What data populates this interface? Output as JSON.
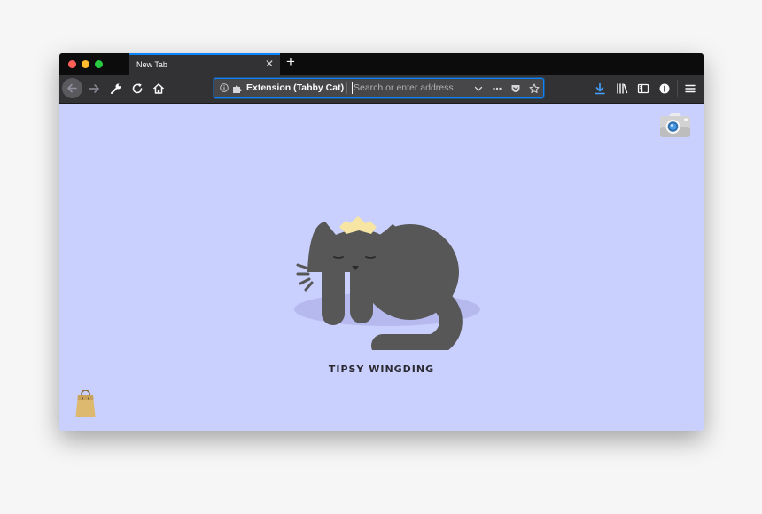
{
  "tab": {
    "title": "New Tab"
  },
  "urlbar": {
    "extension_label": "Extension (Tabby Cat)",
    "placeholder": "Search or enter address"
  },
  "cat": {
    "name": "TIPSY WINGDING"
  },
  "colors": {
    "content_bg": "#cad0fd",
    "cat_fur": "#575757",
    "crown": "#f7e5a3",
    "accent": "#0a84ff",
    "download_icon": "#45a1ff"
  },
  "icons": {
    "toolbar": [
      "back-icon",
      "forward-icon",
      "customize-wrench-icon",
      "reload-icon",
      "home-icon"
    ],
    "urlbar": [
      "info-icon",
      "extension-puzzle-icon",
      "dropdown-chevron-icon",
      "page-actions-icon",
      "pocket-icon",
      "bookmark-star-icon"
    ],
    "right": [
      "downloads-icon",
      "library-icon",
      "sidebar-icon",
      "account-icon",
      "menu-icon"
    ],
    "content": [
      "camera-icon",
      "shopping-bag-icon"
    ]
  }
}
